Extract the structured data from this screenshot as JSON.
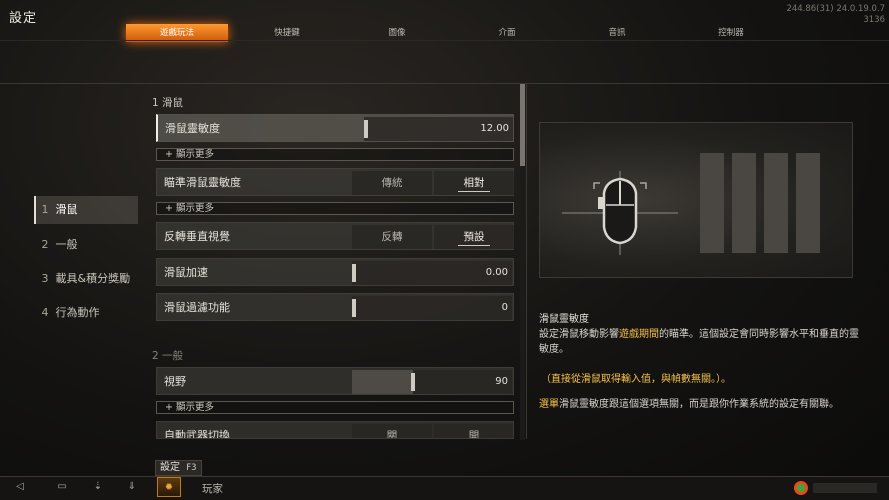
{
  "header": {
    "title": "設定",
    "version_line1": "244.86(31) 24.0.19.0.7",
    "version_line2": "3136"
  },
  "tabs": [
    {
      "label": "遊戲玩法",
      "active": true
    },
    {
      "label": "快捷鍵",
      "active": false
    },
    {
      "label": "圖像",
      "active": false
    },
    {
      "label": "介面",
      "active": false
    },
    {
      "label": "音訊",
      "active": false
    },
    {
      "label": "控制器",
      "active": false
    }
  ],
  "nav": {
    "items": [
      {
        "num": "1",
        "label": "滑鼠",
        "active": true
      },
      {
        "num": "2",
        "label": "一般",
        "active": false
      },
      {
        "num": "3",
        "label": "載具&積分獎勵",
        "active": false
      },
      {
        "num": "4",
        "label": "行為動作",
        "active": false
      }
    ]
  },
  "sections": {
    "mouse_header": "1 滑鼠",
    "general_header": "2 一般"
  },
  "settings": {
    "mouse_sensitivity": {
      "label": "滑鼠靈敏度",
      "value": "12.00",
      "fraction": 0.07
    },
    "show_more": "+ 顯示更多",
    "ads_sensitivity": {
      "label": "瞄準滑鼠靈敏度",
      "opt1": "傳統",
      "opt2": "相對",
      "selected": "相對"
    },
    "invert_y": {
      "label": "反轉垂直視覺",
      "opt1": "反轉",
      "opt2": "預設",
      "selected": "預設"
    },
    "acceleration": {
      "label": "滑鼠加速",
      "value": "0.00",
      "fraction": 0.0
    },
    "filtering": {
      "label": "滑鼠過濾功能",
      "value": "0",
      "fraction": 0.0
    },
    "fov": {
      "label": "視野",
      "value": "90",
      "fraction": 0.38
    },
    "auto_weapon": {
      "label": "自動武器切換",
      "opt1": "關",
      "opt2": "開"
    }
  },
  "detail": {
    "title": "滑鼠靈敏度",
    "desc_part1": "設定滑鼠移動影響",
    "desc_highlight": "遊戲期間",
    "desc_part2": "的瞄準。這個設定會同時影響水平和垂直的靈敏度。",
    "note": "（直接從滑鼠取得輸入值，與幀數無關。）。",
    "desc3_highlight": "選單",
    "desc3_rest": "滑鼠靈敏度跟這個選項無關，而是跟你作業系統的設定有關聯。"
  },
  "bottom": {
    "hint_label": "設定",
    "hint_key": "F3",
    "player_label": "玩家"
  },
  "colors": {
    "accent": "#e07a1c",
    "highlight_text": "#f5c24a"
  }
}
